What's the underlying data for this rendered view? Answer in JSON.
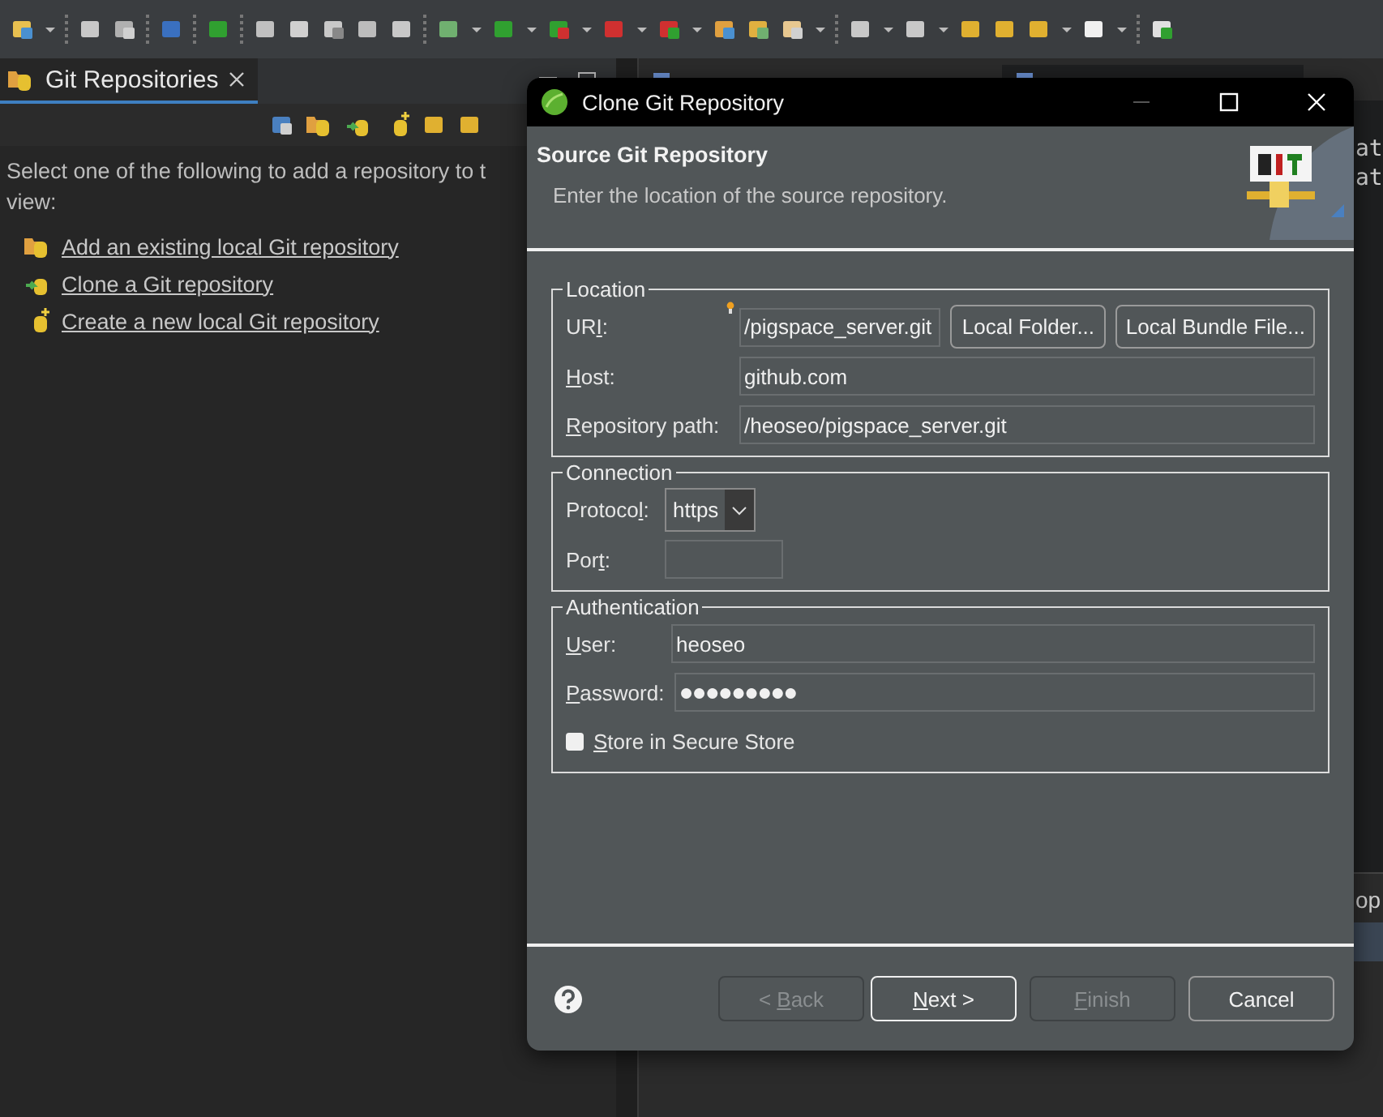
{
  "git_view": {
    "tab": {
      "title": "Git Repositories",
      "selected": true
    },
    "intro_lines": [
      "Select one of the following to add a repository to t",
      "view:"
    ],
    "links": [
      {
        "label": "Add an existing local Git repository",
        "kind": "add"
      },
      {
        "label": "Clone a Git repository",
        "kind": "clone"
      },
      {
        "label": "Create a new local Git repository",
        "kind": "create"
      }
    ]
  },
  "editor": {
    "tabs": [
      {
        "selected": false
      },
      {
        "selected": true
      }
    ],
    "code_lines": [
      "at",
      "at"
    ],
    "bottom_panel": {
      "title": "op"
    }
  },
  "dialog": {
    "title": "Clone Git Repository",
    "header_title": "Source Git Repository",
    "header_message": "Enter the location of the source repository.",
    "groups": [
      {
        "title": "Location",
        "rows": [
          {
            "label": {
              "before": "UR",
              "key": "I",
              "after": ":"
            },
            "kind": "uri",
            "value": "/pigspace_server.git",
            "buttons": [
              "Local Folder...",
              "Local Bundle File..."
            ]
          },
          {
            "label": {
              "key": "H",
              "after": "ost:"
            },
            "kind": "text",
            "value": "github.com"
          },
          {
            "label": {
              "key": "R",
              "after": "epository path:"
            },
            "kind": "text",
            "value": "/heoseo/pigspace_server.git"
          }
        ]
      },
      {
        "title": "Connection",
        "rows": [
          {
            "label": {
              "before": "Protoco",
              "key": "l",
              "after": ":"
            },
            "kind": "select",
            "value": "https"
          },
          {
            "label": {
              "before": "Por",
              "key": "t",
              "after": ":"
            },
            "kind": "short"
          }
        ]
      },
      {
        "title": "Authentication",
        "rows": [
          {
            "label": {
              "key": "U",
              "after": "ser:"
            },
            "kind": "text",
            "value": "heoseo"
          },
          {
            "label": {
              "key": "P",
              "after": "assword:"
            },
            "kind": "password",
            "value": "●●●●●●●●●"
          },
          {
            "label": {
              "key": "S",
              "after": "tore in Secure Store"
            },
            "kind": "checkbox",
            "checked": false
          }
        ]
      }
    ],
    "buttons": [
      {
        "label": {
          "before": "< ",
          "key": "B",
          "after": "ack"
        },
        "disabled": true,
        "default": false
      },
      {
        "label": {
          "key": "N",
          "after": "ext >"
        },
        "disabled": false,
        "default": true
      },
      {
        "label": {
          "key": "F",
          "after": "inish"
        },
        "disabled": true,
        "default": false
      },
      {
        "label": {
          "before": "Cancel"
        },
        "disabled": false,
        "default": false
      }
    ]
  }
}
